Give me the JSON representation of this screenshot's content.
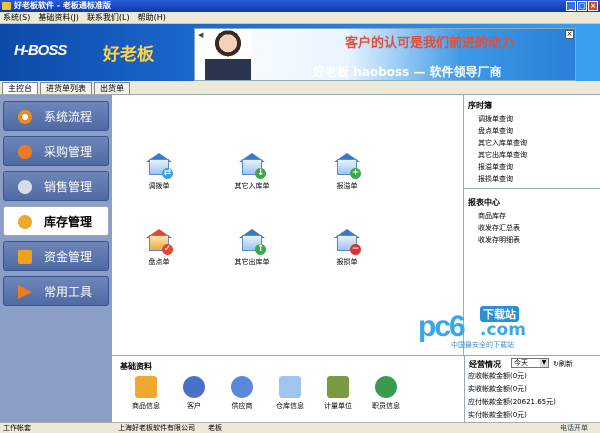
{
  "window": {
    "title": "好老板软件 - 老板通标准版",
    "minimize": "_",
    "maximize": "□",
    "close": "×"
  },
  "menu": [
    "系统(S)",
    "基础资料(J)",
    "联系我们(L)",
    "帮助(H)"
  ],
  "header": {
    "logo_en": "H-BOSS",
    "logo_cn": "好老板",
    "banner_slogan": "客户的认可是我们前进的动力",
    "banner_brand": "好老板 haoboss — 软件领导厂商",
    "banner_close": "×",
    "banner_nav": "◀ II ▶"
  },
  "tabs": [
    "主控台",
    "进货单列表",
    "出货单"
  ],
  "sidebar": [
    "系统流程",
    "采购管理",
    "销售管理",
    "库存管理",
    "资金管理",
    "常用工具"
  ],
  "functions": [
    "调拨单",
    "其它入库单",
    "报溢单",
    "盘点单",
    "其它出库单",
    "报损单"
  ],
  "sequence": {
    "title": "序时簿",
    "links": [
      "调拨单查询",
      "盘点单查询",
      "其它入库单查询",
      "其它出库单查询",
      "报溢单查询",
      "报损单查询"
    ]
  },
  "reports": {
    "title": "报表中心",
    "links": [
      "商品库存",
      "收发存汇总表",
      "收发存明细表"
    ]
  },
  "basic": {
    "title": "基础资料",
    "items": [
      "商品信息",
      "客户",
      "供应商",
      "仓库信息",
      "计量单位",
      "职员信息"
    ]
  },
  "business": {
    "title": "经营情况",
    "period": "今天",
    "refresh": "刷新",
    "lines": [
      "应收帐款金额(0元)",
      "实收帐款金额(0元)",
      "应付帐款金额(20621.65元)",
      "实付帐款金额(0元)"
    ]
  },
  "watermark": {
    "brand": "pc6",
    "download": "下载站",
    "domain": ".com",
    "tagline": "中国最安全的下载站"
  },
  "status": {
    "left": "工作帐套",
    "company": "上海好老板软件有限公司",
    "user": "老板",
    "right": "电话开单"
  },
  "colors": {
    "accent": "#2a5bd7",
    "sidebar": "#8a9ec8"
  }
}
